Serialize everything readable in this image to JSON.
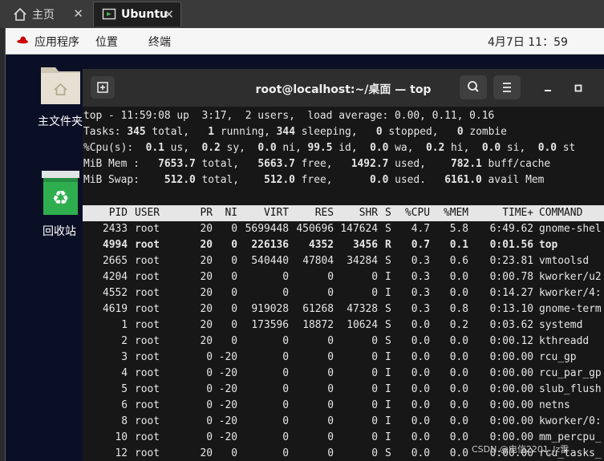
{
  "tabs": [
    {
      "label": "主页",
      "icon": "home-icon"
    },
    {
      "label": "Ubuntu",
      "icon": "vm-icon"
    }
  ],
  "topbar": {
    "apps": "应用程序",
    "places": "位置",
    "terminal": "终端",
    "clock": "4月7日  11：59"
  },
  "desktop": {
    "folder_label": "主文件夹",
    "trash_label": "回收站"
  },
  "terminal": {
    "title": "root@localhost:~/桌面 — top",
    "summary": {
      "line1": "top - 11:59:08 up  3:17,  2 users,  load average: 0.00, 0.11, 0.16",
      "tasks_label": "Tasks:",
      "tasks_total": "345",
      "tasks_total_label": "total,",
      "tasks_running": "1",
      "tasks_running_label": "running,",
      "tasks_sleeping": "344",
      "tasks_sleeping_label": "sleeping,",
      "tasks_stopped": "0",
      "tasks_stopped_label": "stopped,",
      "tasks_zombie": "0",
      "tasks_zombie_label": "zombie",
      "cpu_label": "%Cpu(s):",
      "cpu_us": "0.1",
      "cpu_sy": "0.2",
      "cpu_ni": "0.0",
      "cpu_id": "99.5",
      "cpu_wa": "0.0",
      "cpu_hi": "0.2",
      "cpu_si": "0.0",
      "cpu_st": "0.0",
      "mem_label": "MiB Mem :",
      "mem_total": "7653.7",
      "mem_free": "5663.7",
      "mem_used": "1492.7",
      "mem_buff": "782.1",
      "swap_label": "MiB Swap:",
      "swap_total": "512.0",
      "swap_free": "512.0",
      "swap_used": "0.0",
      "swap_avail": "6161.0"
    },
    "columns": [
      "PID",
      "USER",
      "PR",
      "NI",
      "VIRT",
      "RES",
      "SHR",
      "S",
      "%CPU",
      "%MEM",
      "TIME+",
      "COMMAND"
    ],
    "processes": [
      {
        "pid": "2433",
        "user": "root",
        "pr": "20",
        "ni": "0",
        "virt": "5699448",
        "res": "450696",
        "shr": "147624",
        "s": "S",
        "cpu": "4.7",
        "mem": "5.8",
        "time": "6:49.62",
        "cmd": "gnome-shel",
        "bold": false
      },
      {
        "pid": "4994",
        "user": "root",
        "pr": "20",
        "ni": "0",
        "virt": "226136",
        "res": "4352",
        "shr": "3456",
        "s": "R",
        "cpu": "0.7",
        "mem": "0.1",
        "time": "0:01.56",
        "cmd": "top",
        "bold": true
      },
      {
        "pid": "2665",
        "user": "root",
        "pr": "20",
        "ni": "0",
        "virt": "540440",
        "res": "47804",
        "shr": "34284",
        "s": "S",
        "cpu": "0.3",
        "mem": "0.6",
        "time": "0:23.81",
        "cmd": "vmtoolsd",
        "bold": false
      },
      {
        "pid": "4204",
        "user": "root",
        "pr": "20",
        "ni": "0",
        "virt": "0",
        "res": "0",
        "shr": "0",
        "s": "I",
        "cpu": "0.3",
        "mem": "0.0",
        "time": "0:00.78",
        "cmd": "kworker/u2",
        "bold": false
      },
      {
        "pid": "4552",
        "user": "root",
        "pr": "20",
        "ni": "0",
        "virt": "0",
        "res": "0",
        "shr": "0",
        "s": "I",
        "cpu": "0.3",
        "mem": "0.0",
        "time": "0:14.27",
        "cmd": "kworker/4:",
        "bold": false
      },
      {
        "pid": "4619",
        "user": "root",
        "pr": "20",
        "ni": "0",
        "virt": "919028",
        "res": "61268",
        "shr": "47328",
        "s": "S",
        "cpu": "0.3",
        "mem": "0.8",
        "time": "0:13.10",
        "cmd": "gnome-term",
        "bold": false
      },
      {
        "pid": "1",
        "user": "root",
        "pr": "20",
        "ni": "0",
        "virt": "173596",
        "res": "18872",
        "shr": "10624",
        "s": "S",
        "cpu": "0.0",
        "mem": "0.2",
        "time": "0:03.62",
        "cmd": "systemd",
        "bold": false
      },
      {
        "pid": "2",
        "user": "root",
        "pr": "20",
        "ni": "0",
        "virt": "0",
        "res": "0",
        "shr": "0",
        "s": "S",
        "cpu": "0.0",
        "mem": "0.0",
        "time": "0:00.12",
        "cmd": "kthreadd",
        "bold": false
      },
      {
        "pid": "3",
        "user": "root",
        "pr": "0",
        "ni": "-20",
        "virt": "0",
        "res": "0",
        "shr": "0",
        "s": "I",
        "cpu": "0.0",
        "mem": "0.0",
        "time": "0:00.00",
        "cmd": "rcu_gp",
        "bold": false
      },
      {
        "pid": "4",
        "user": "root",
        "pr": "0",
        "ni": "-20",
        "virt": "0",
        "res": "0",
        "shr": "0",
        "s": "I",
        "cpu": "0.0",
        "mem": "0.0",
        "time": "0:00.00",
        "cmd": "rcu_par_gp",
        "bold": false
      },
      {
        "pid": "5",
        "user": "root",
        "pr": "0",
        "ni": "-20",
        "virt": "0",
        "res": "0",
        "shr": "0",
        "s": "I",
        "cpu": "0.0",
        "mem": "0.0",
        "time": "0:00.00",
        "cmd": "slub_flush",
        "bold": false
      },
      {
        "pid": "6",
        "user": "root",
        "pr": "0",
        "ni": "-20",
        "virt": "0",
        "res": "0",
        "shr": "0",
        "s": "I",
        "cpu": "0.0",
        "mem": "0.0",
        "time": "0:00.00",
        "cmd": "netns",
        "bold": false
      },
      {
        "pid": "8",
        "user": "root",
        "pr": "0",
        "ni": "-20",
        "virt": "0",
        "res": "0",
        "shr": "0",
        "s": "I",
        "cpu": "0.0",
        "mem": "0.0",
        "time": "0:00.00",
        "cmd": "kworker/0:",
        "bold": false
      },
      {
        "pid": "10",
        "user": "root",
        "pr": "0",
        "ni": "-20",
        "virt": "0",
        "res": "0",
        "shr": "0",
        "s": "I",
        "cpu": "0.0",
        "mem": "0.0",
        "time": "0:00.00",
        "cmd": "mm_percpu_",
        "bold": false
      },
      {
        "pid": "12",
        "user": "root",
        "pr": "20",
        "ni": "0",
        "virt": "0",
        "res": "0",
        "shr": "0",
        "s": "S",
        "cpu": "0.0",
        "mem": "0.0",
        "time": "0:00.00",
        "cmd": "rcu_tasks_",
        "bold": false
      }
    ]
  },
  "watermark": "CSDN @电信2201_lz雷",
  "colors": {
    "terminal_bg": "#171717",
    "header_bg": "#2e2e2e",
    "desktop_bg": "#0b0f26",
    "row_header_bg": "#e6e6e6",
    "hat_red": "#cc0000",
    "trash_green": "#2fae4f"
  }
}
